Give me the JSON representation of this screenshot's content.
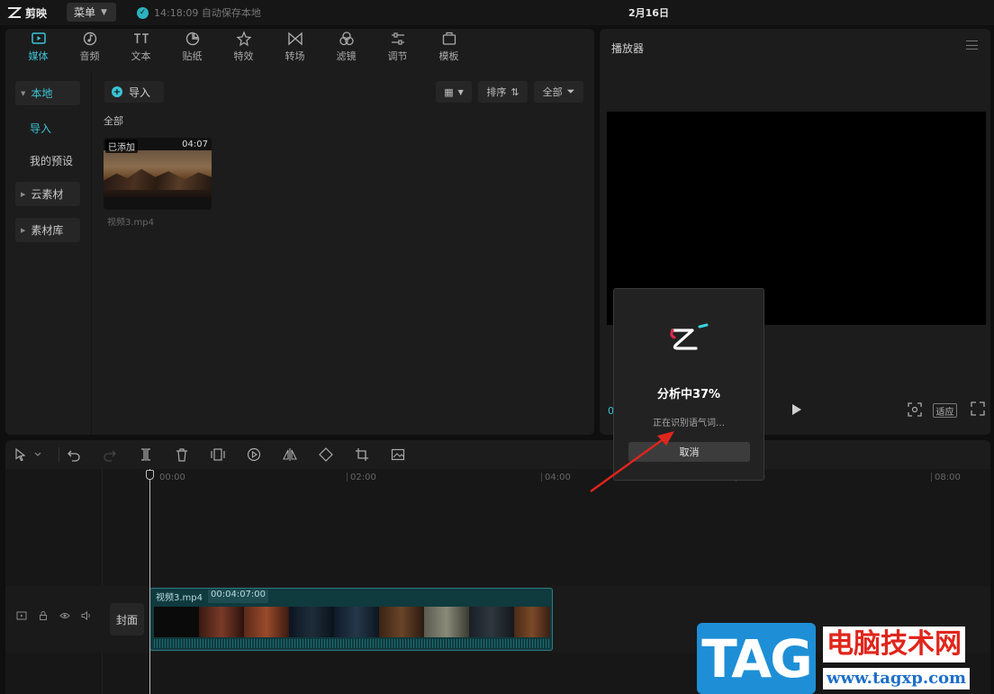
{
  "titlebar": {
    "app_name": "剪映",
    "menu_label": "菜单",
    "autosave": "14:18:09 自动保存本地",
    "project_title": "2月16日"
  },
  "media_tabs": [
    {
      "label": "媒体",
      "icon": "media-icon",
      "active": true
    },
    {
      "label": "音频",
      "icon": "audio-icon"
    },
    {
      "label": "文本",
      "icon": "text-icon"
    },
    {
      "label": "贴纸",
      "icon": "sticker-icon"
    },
    {
      "label": "特效",
      "icon": "effects-icon"
    },
    {
      "label": "转场",
      "icon": "transition-icon"
    },
    {
      "label": "滤镜",
      "icon": "filter-icon"
    },
    {
      "label": "调节",
      "icon": "adjust-icon"
    },
    {
      "label": "模板",
      "icon": "template-icon"
    }
  ],
  "sidebar": {
    "local": "本地",
    "import": "导入",
    "my_presets": "我的预设",
    "cloud": "云素材",
    "library": "素材库"
  },
  "media": {
    "import_label": "导入",
    "sort_label": "排序",
    "filter_label": "全部",
    "section_label": "全部",
    "clip": {
      "badge": "已添加",
      "duration": "04:07",
      "name": "视频3.mp4"
    }
  },
  "player": {
    "title": "播放器",
    "time": "0",
    "fit_label": "适应"
  },
  "timeline": {
    "ticks": [
      "00:00",
      "02:00",
      "04:00",
      "06:00",
      "08:00"
    ],
    "cover_label": "封面",
    "clip_name": "视频3.mp4",
    "clip_duration": "00:04:07:00"
  },
  "modal": {
    "title": "分析中37%",
    "status": "正在识别语气词…",
    "cancel_label": "取消"
  },
  "watermark": {
    "tag": "TAG",
    "site_name": "电脑技术网",
    "url": "www.tagxp.com"
  },
  "colors": {
    "accent": "#3cc3d6",
    "arrow": "#e0261c",
    "watermark_blue": "#1e8fd6"
  }
}
